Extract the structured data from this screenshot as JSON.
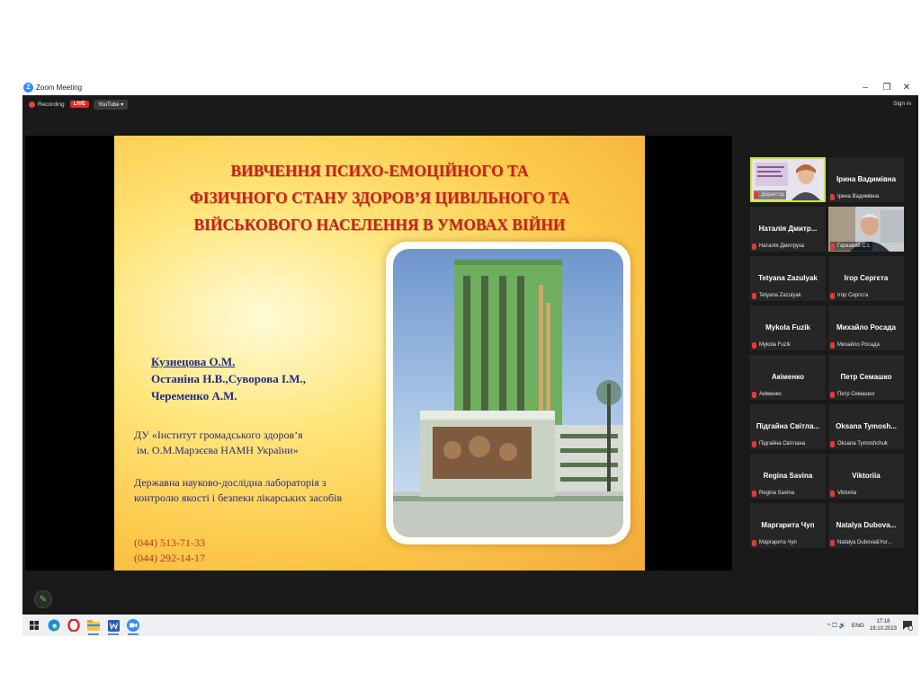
{
  "window": {
    "title": "Zoom Meeting",
    "minimize": "–",
    "restore": "❐",
    "close": "✕"
  },
  "topbar": {
    "recording": "Recording",
    "live": "LIVE",
    "stream": "YouTube ▾",
    "signin": "Sign in"
  },
  "slide": {
    "title_lines": [
      "ВИВЧЕННЯ ПСИХО-ЕМОЦІЙНОГО ТА",
      "ФІЗИЧНОГО СТАНУ ЗДОРОВ’Я ЦИВІЛЬНОГО ТА",
      "ВІЙСЬКОВОГО НАСЕЛЕННЯ В УМОВАХ ВІЙНИ"
    ],
    "authors": [
      "Кузнецова О.М.",
      "Останіна Н.В.,Суворова І.М.,",
      "Череменко А.М."
    ],
    "institute": [
      "ДУ «Інститут громадського здоров’я",
      "ім. О.М.Марзєєва НАМН України»"
    ],
    "lab": [
      "Державна науково-дослідна лабораторія з",
      "контролю якості і безпеки лікарських засобів"
    ],
    "phones": [
      "(044) 513-71-33",
      "(044) 292-14-17"
    ]
  },
  "participants": [
    {
      "name": "",
      "label": "Директор",
      "video": true,
      "active": true
    },
    {
      "name": "Ірина Вадимівна",
      "label": "Ірина Вадимівна"
    },
    {
      "name": "Наталія Дмитр...",
      "label": "Наталія Дмитруха"
    },
    {
      "name": "",
      "label": "Гаркавий С.І.",
      "video": true
    },
    {
      "name": "Tetyana Zazulyak",
      "label": "Tetyana Zazulyak"
    },
    {
      "name": "Ігор Сергєта",
      "label": "Ігор Сергєта"
    },
    {
      "name": "Mykola Fuzik",
      "label": "Mykola Fuzik"
    },
    {
      "name": "Михайло Росада",
      "label": "Михайло Росада"
    },
    {
      "name": "Акіменко",
      "label": "Акіменко"
    },
    {
      "name": "Петр Семашко",
      "label": "Петр Семашко"
    },
    {
      "name": "Підгайна Світла...",
      "label": "Підгайна Світлана"
    },
    {
      "name": "Oksana Tymosh...",
      "label": "Oksana Tymoshchuk"
    },
    {
      "name": "Regina Savina",
      "label": "Regina Savina"
    },
    {
      "name": "Viktoriia",
      "label": "Viktoriia"
    },
    {
      "name": "Маргарита Чуп",
      "label": "Маргарита Чуп"
    },
    {
      "name": "Natalya Dubova...",
      "label": "Natalya Dubova&Yur..."
    }
  ],
  "taskbar": {
    "lang": "ENG",
    "time": "17:18",
    "date": "19.10.2023",
    "tray_icons": "^ 🖵 🔊"
  },
  "colors": {
    "accent": "#2d8cff",
    "live": "#e02828",
    "slide_title": "#c8201e",
    "active_speaker": "#c9e82c"
  }
}
